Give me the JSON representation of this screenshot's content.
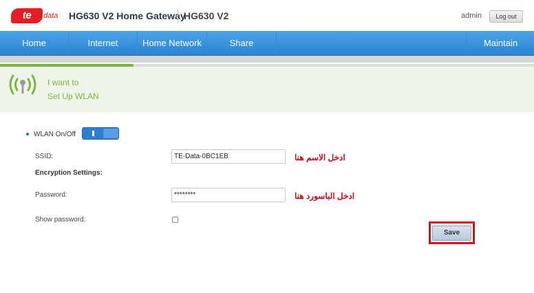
{
  "header": {
    "logo_text": "te",
    "logo_sub": "data",
    "title": "HG630 V2 Home Gateway",
    "model": "HG630 V2",
    "user": "admin",
    "logout_label": "Log out"
  },
  "nav": {
    "items": [
      "Home",
      "Internet",
      "Home Network",
      "Share"
    ],
    "maintain": "Maintain"
  },
  "progress": {
    "fraction": 0.25
  },
  "banner": {
    "line1": "I want to",
    "line2": "Set Up WLAN"
  },
  "wlan": {
    "label": "WLAN On/Off",
    "state": "on"
  },
  "form": {
    "ssid_label": "SSID:",
    "ssid_value": "TE-Data-0BC1EB",
    "encryption_heading": "Encryption Settings:",
    "password_label": "Password:",
    "password_value": "********",
    "show_password_label": "Show password:",
    "show_password_checked": false,
    "save_label": "Save"
  },
  "notes": {
    "ssid_note": "ادخل الاسم هنا",
    "password_note": "ادخل الباسورد هنا"
  },
  "colors": {
    "brand_red": "#e31e24",
    "nav_blue": "#2a84d2",
    "banner_green": "#7cb342",
    "highlight_red": "#e0001b"
  }
}
